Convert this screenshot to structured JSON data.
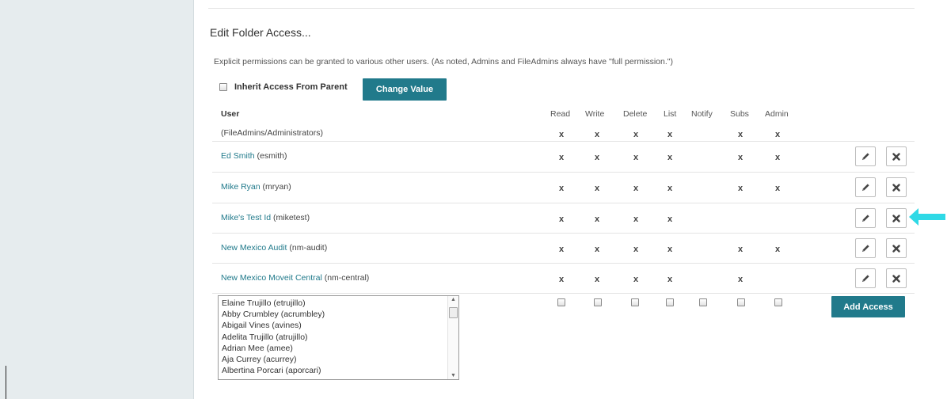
{
  "title": "Edit Folder Access...",
  "description": "Explicit permissions can be granted to various other users. (As noted, Admins and FileAdmins always have \"full permission.\")",
  "inherit": {
    "label": "Inherit Access From Parent",
    "checked": false
  },
  "change_button": "Change Value",
  "columns": {
    "user": "User",
    "read": "Read",
    "write": "Write",
    "delete": "Delete",
    "list": "List",
    "notify": "Notify",
    "subs": "Subs",
    "admin": "Admin"
  },
  "mark": "x",
  "rows": [
    {
      "name": "",
      "id": "(FileAdmins/Administrators)",
      "perms": {
        "read": true,
        "write": true,
        "delete": true,
        "list": true,
        "notify": false,
        "subs": true,
        "admin": true
      },
      "editable": false
    },
    {
      "name": "Ed Smith",
      "id": " (esmith)",
      "perms": {
        "read": true,
        "write": true,
        "delete": true,
        "list": true,
        "notify": false,
        "subs": true,
        "admin": true
      },
      "editable": true
    },
    {
      "name": "Mike Ryan",
      "id": " (mryan)",
      "perms": {
        "read": true,
        "write": true,
        "delete": true,
        "list": true,
        "notify": false,
        "subs": true,
        "admin": true
      },
      "editable": true
    },
    {
      "name": "Mike's Test Id",
      "id": " (miketest)",
      "perms": {
        "read": true,
        "write": true,
        "delete": true,
        "list": true,
        "notify": false,
        "subs": false,
        "admin": false
      },
      "editable": true
    },
    {
      "name": "New Mexico Audit",
      "id": "  (nm-audit)",
      "perms": {
        "read": true,
        "write": true,
        "delete": true,
        "list": true,
        "notify": false,
        "subs": true,
        "admin": true
      },
      "editable": true
    },
    {
      "name": "New Mexico Moveit Central",
      "id": " (nm-central)",
      "perms": {
        "read": true,
        "write": true,
        "delete": true,
        "list": true,
        "notify": false,
        "subs": true,
        "admin": false
      },
      "editable": true
    }
  ],
  "user_list": [
    "Elaine Trujillo  (etrujillo)",
    "Abby Crumbley  (acrumbley)",
    "Abigail Vines (avines)",
    "Adelita Trujillo (atrujillo)",
    "Adrian Mee (amee)",
    "Aja Currey (acurrey)",
    "Albertina Porcari (aporcari)"
  ],
  "add_button": "Add Access",
  "icons": {
    "edit": "pencil-icon",
    "delete": "close-icon",
    "callout": "arrow-left-icon"
  },
  "colors": {
    "accent": "#217a8b",
    "link": "#217a8b",
    "callout": "#2fd9e6",
    "sidebar": "#e6ecee"
  }
}
